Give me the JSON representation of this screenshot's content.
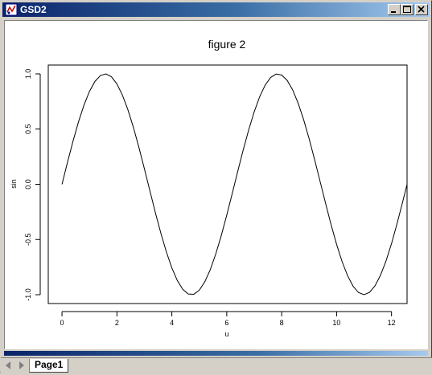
{
  "window": {
    "title": "GSD2",
    "buttons": {
      "minimize_icon": "minimize-icon",
      "maximize_icon": "maximize-icon",
      "close_icon": "close-icon"
    }
  },
  "tabs": {
    "items": [
      {
        "label": "Page1",
        "active": true
      }
    ],
    "nav": {
      "prev_icon": "triangle-left-icon",
      "next_icon": "triangle-right-icon"
    }
  },
  "colors": {
    "titlebar_start": "#0a246a",
    "titlebar_end": "#a6caf0",
    "frame": "#d4d0c8",
    "plot_background": "#ffffff",
    "series_line": "#000000"
  },
  "chart_data": {
    "type": "line",
    "title": "figure 2",
    "xlabel": "u",
    "ylabel": "sin",
    "xlim": [
      -0.5,
      12.566
    ],
    "ylim": [
      -1.08,
      1.08
    ],
    "xticks": [
      0,
      2,
      4,
      6,
      8,
      10,
      12
    ],
    "xtick_labels": [
      "0",
      "2",
      "4",
      "6",
      "8",
      "10",
      "12"
    ],
    "yticks": [
      -1.0,
      -0.5,
      0.0,
      0.5,
      1.0
    ],
    "ytick_labels": [
      "-1.0",
      "-0.5",
      "0.0",
      "0.5",
      "1.0"
    ],
    "grid": false,
    "legend": "none",
    "series": [
      {
        "x": [
          0,
          0.2,
          0.4,
          0.6,
          0.8,
          1.0,
          1.2,
          1.4,
          1.6,
          1.8,
          2.0,
          2.2,
          2.4,
          2.6,
          2.8,
          3.0,
          3.2,
          3.4,
          3.6,
          3.8,
          4.0,
          4.2,
          4.4,
          4.6,
          4.8,
          5.0,
          5.2,
          5.4,
          5.6,
          5.8,
          6.0,
          6.2,
          6.4,
          6.6,
          6.8,
          7.0,
          7.2,
          7.4,
          7.6,
          7.8,
          8.0,
          8.2,
          8.4,
          8.6,
          8.8,
          9.0,
          9.2,
          9.4,
          9.6,
          9.8,
          10.0,
          10.2,
          10.4,
          10.6,
          10.8,
          11.0,
          11.2,
          11.4,
          11.6,
          11.8,
          12.0,
          12.2,
          12.4,
          12.566
        ],
        "y": [
          0.0,
          0.199,
          0.389,
          0.565,
          0.717,
          0.841,
          0.932,
          0.985,
          1.0,
          0.974,
          0.909,
          0.808,
          0.675,
          0.516,
          0.335,
          0.141,
          -0.058,
          -0.256,
          -0.443,
          -0.612,
          -0.757,
          -0.872,
          -0.952,
          -0.994,
          -0.996,
          -0.959,
          -0.883,
          -0.773,
          -0.631,
          -0.465,
          -0.279,
          -0.083,
          0.117,
          0.312,
          0.494,
          0.657,
          0.794,
          0.899,
          0.968,
          0.999,
          0.989,
          0.941,
          0.855,
          0.734,
          0.585,
          0.412,
          0.223,
          0.025,
          -0.174,
          -0.366,
          -0.544,
          -0.7,
          -0.828,
          -0.923,
          -0.981,
          -1.0,
          -0.979,
          -0.919,
          -0.823,
          -0.694,
          -0.537,
          -0.357,
          -0.165,
          0.0
        ]
      }
    ]
  }
}
